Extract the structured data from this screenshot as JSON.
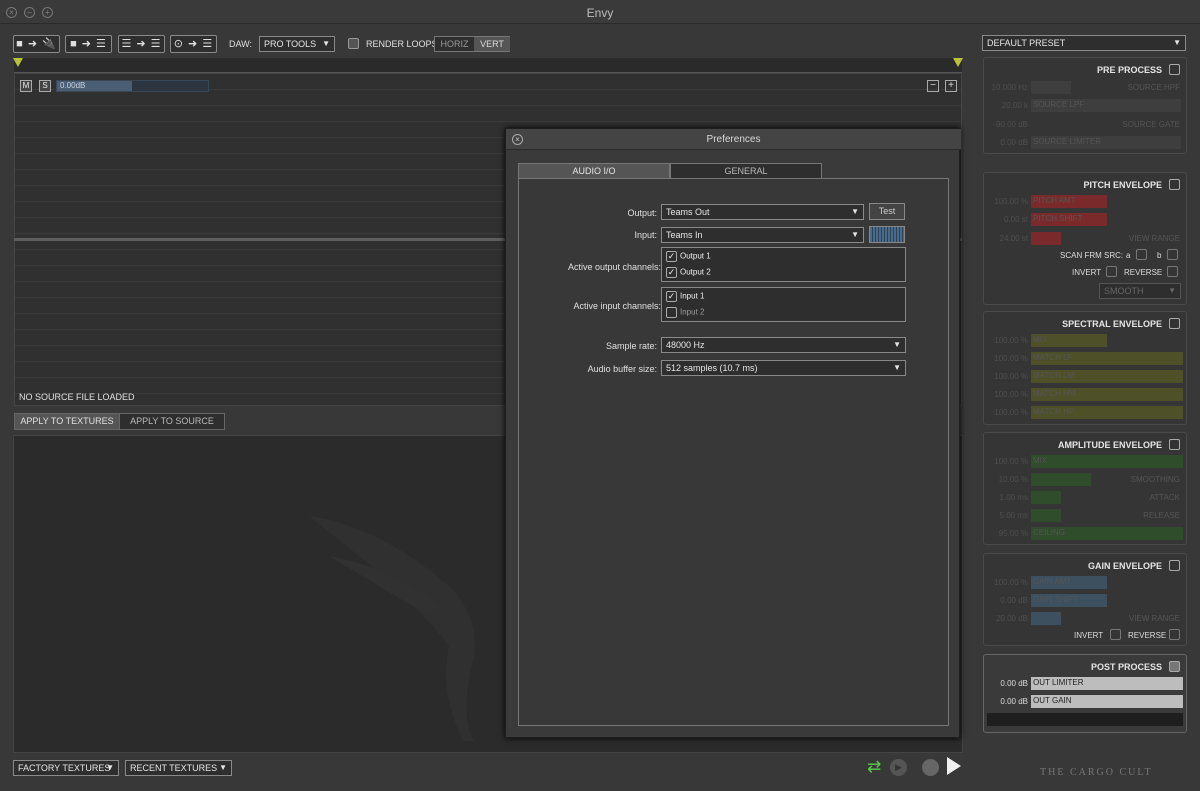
{
  "window": {
    "title": "Envy"
  },
  "toolbar": {
    "btn1": "■ ➜ 🔌",
    "btn2": "■ ➜ ☰",
    "btn3": "☰ ➜ ☰",
    "btn4": "⊙ ➜ ☰",
    "daw_label": "DAW:",
    "daw_value": "PRO TOOLS",
    "render_loops": "RENDER LOOPS",
    "horiz": "HORIZ",
    "vert": "VERT"
  },
  "track": {
    "m": "M",
    "s": "S",
    "gain": "0.00dB",
    "no_source": "NO SOURCE FILE LOADED",
    "minus": "−",
    "plus": "+"
  },
  "texture_tabs": {
    "apply_textures": "APPLY TO TEXTURES",
    "apply_source": "APPLY TO SOURCE"
  },
  "bottom": {
    "factory": "FACTORY TEXTURES",
    "recent": "RECENT TEXTURES",
    "brand": "THE CARGO CULT"
  },
  "preset": {
    "value": "DEFAULT PRESET"
  },
  "pre_process": {
    "title": "PRE PROCESS",
    "rows": [
      {
        "val": "10.000 Hz",
        "bar": "",
        "label": "SOURCE HPF"
      },
      {
        "val": "20.00 k",
        "bar": "SOURCE LPF",
        "label": ""
      },
      {
        "val": "-90.00 dB",
        "bar": "",
        "label": "SOURCE GATE"
      },
      {
        "val": "0.00 dB",
        "bar": "SOURCE LIMITER",
        "label": ""
      }
    ]
  },
  "pitch_envelope": {
    "title": "PITCH ENVELOPE",
    "rows": [
      {
        "val": "100.00 %",
        "bar": "PITCH AMT",
        "label": ""
      },
      {
        "val": "0.00 st",
        "bar": "PITCH SHIFT",
        "label": ""
      },
      {
        "val": "24.00 st",
        "bar": "",
        "label": "VIEW RANGE"
      }
    ],
    "scan": "SCAN FRM SRC:",
    "a": "a",
    "b": "b",
    "invert": "INVERT",
    "reverse": "REVERSE",
    "smooth": "SMOOTH"
  },
  "spectral_envelope": {
    "title": "SPECTRAL ENVELOPE",
    "rows": [
      {
        "val": "100.00 %",
        "bar": "MIX"
      },
      {
        "val": "100.00 %",
        "bar": "MATCH LF"
      },
      {
        "val": "100.00 %",
        "bar": "MATCH LM"
      },
      {
        "val": "100.00 %",
        "bar": "MATCH HM"
      },
      {
        "val": "100.00 %",
        "bar": "MATCH HF"
      }
    ]
  },
  "amplitude_envelope": {
    "title": "AMPLITUDE ENVELOPE",
    "rows": [
      {
        "val": "100.00 %",
        "bar": "MIX",
        "label": ""
      },
      {
        "val": "10.00 %",
        "bar": "",
        "label": "SMOOTHING"
      },
      {
        "val": "1.00 ms",
        "bar": "",
        "label": "ATTACK"
      },
      {
        "val": "5.00 ms",
        "bar": "",
        "label": "RELEASE"
      },
      {
        "val": "95.00 %",
        "bar": "CEILING",
        "label": ""
      }
    ]
  },
  "gain_envelope": {
    "title": "GAIN ENVELOPE",
    "rows": [
      {
        "val": "100.00 %",
        "bar": "GAIN AMT",
        "label": ""
      },
      {
        "val": "0.00 dB",
        "bar": "GAIN SHIFT",
        "label": ""
      },
      {
        "val": "20.00 dB",
        "bar": "",
        "label": "VIEW RANGE"
      }
    ],
    "invert": "INVERT",
    "reverse": "REVERSE"
  },
  "post_process": {
    "title": "POST PROCESS",
    "rows": [
      {
        "val": "0.00 dB",
        "bar": "OUT LIMITER"
      },
      {
        "val": "0.00 dB",
        "bar": "OUT GAIN"
      }
    ]
  },
  "preferences": {
    "title": "Preferences",
    "tab_audio": "AUDIO I/O",
    "tab_general": "GENERAL",
    "output_label": "Output:",
    "output_value": "Teams Out",
    "test": "Test",
    "input_label": "Input:",
    "input_value": "Teams In",
    "active_out_label": "Active output channels:",
    "out_ch1": "Output 1",
    "out_ch2": "Output 2",
    "active_in_label": "Active input channels:",
    "in_ch1": "Input 1",
    "in_ch2": "Input 2",
    "sample_rate_label": "Sample rate:",
    "sample_rate_value": "48000 Hz",
    "buffer_label": "Audio buffer size:",
    "buffer_value": "512 samples (10.7 ms)"
  },
  "colors": {
    "pitch": "#7a2a2a",
    "spectral": "#4e5128",
    "amplitude": "#2f4d2a",
    "gain": "#3d5060",
    "accent_green": "#5acb4a"
  }
}
